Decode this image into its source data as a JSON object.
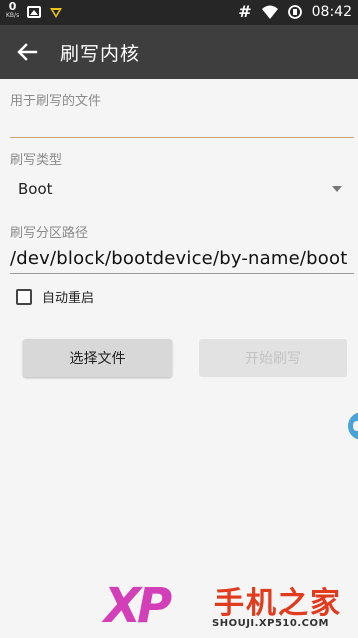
{
  "status_bar": {
    "net_speed": "0",
    "net_unit": "KB/s",
    "hash": "#",
    "time": "08:42"
  },
  "app_bar": {
    "title": "刷写内核"
  },
  "form": {
    "file_label": "用于刷写的文件",
    "file_value": "",
    "type_label": "刷写类型",
    "type_value": "Boot",
    "path_label": "刷写分区路径",
    "path_value": "/dev/block/bootdevice/by-name/boot",
    "reboot_label": "自动重启",
    "reboot_checked": false
  },
  "buttons": {
    "select_file": "选择文件",
    "flash": "开始刷写"
  },
  "watermark": {
    "logo": "XP",
    "name": "手机之家",
    "url": "SHOUJI.XP510.COM"
  },
  "colors": {
    "status_bar": "#262626",
    "app_bar": "#3e3e3e",
    "background": "#f5f5f5",
    "accent_underline": "#c9a96b"
  }
}
